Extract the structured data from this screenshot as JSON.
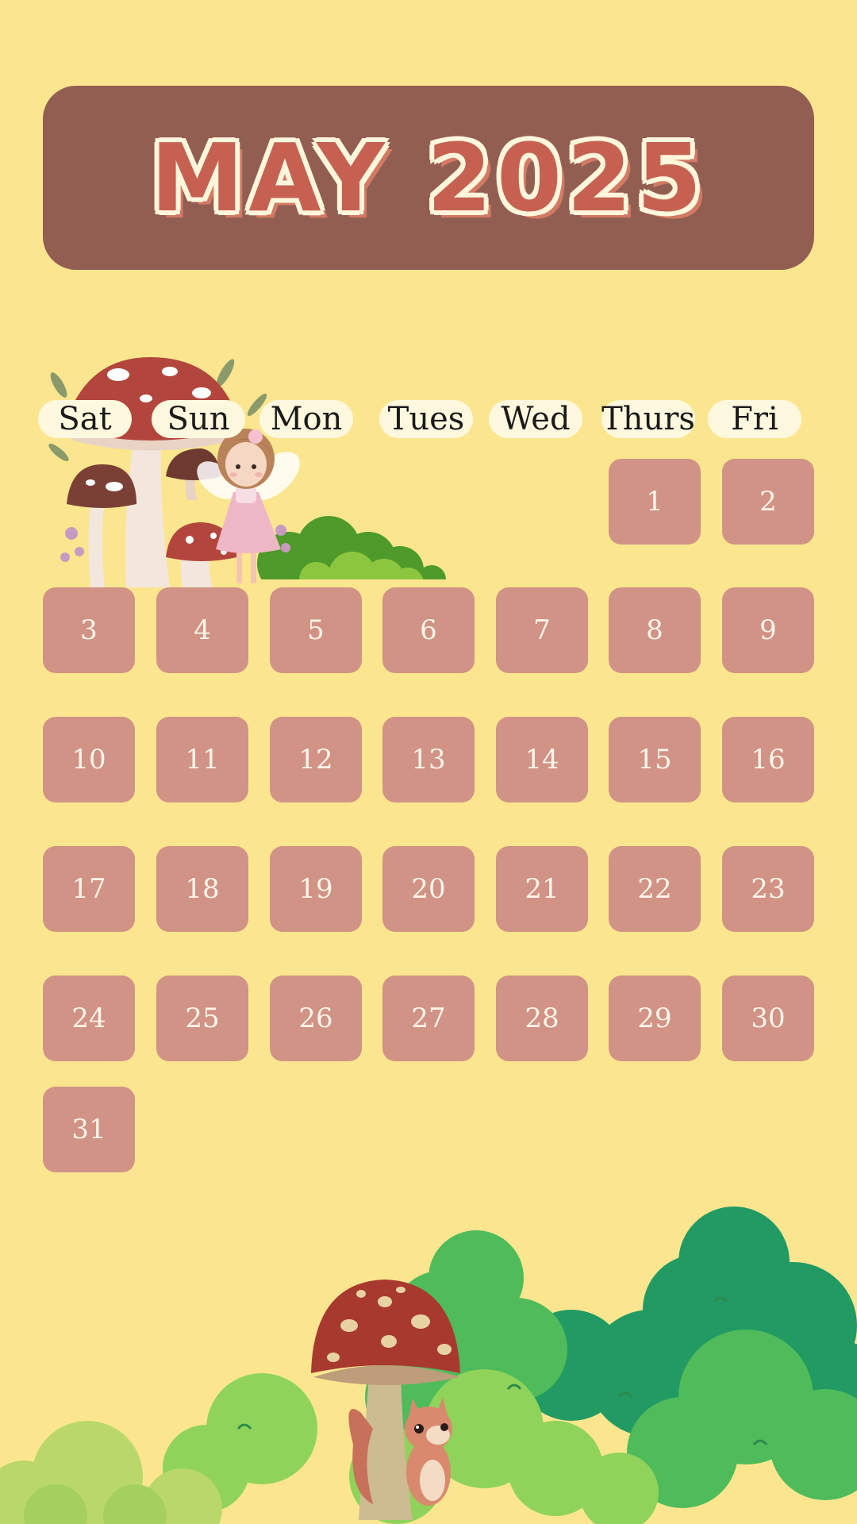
{
  "header": {
    "title": "MAY 2025"
  },
  "weekdays": [
    "Sat",
    "Sun",
    "Mon",
    "Tues",
    "Wed",
    "Thurs",
    "Fri"
  ],
  "days": [
    "1",
    "2",
    "3",
    "4",
    "5",
    "6",
    "7",
    "8",
    "9",
    "10",
    "11",
    "12",
    "13",
    "14",
    "15",
    "16",
    "17",
    "18",
    "19",
    "20",
    "21",
    "22",
    "23",
    "24",
    "25",
    "26",
    "27",
    "28",
    "29",
    "30",
    "31"
  ],
  "colors": {
    "background": "#fbe68f",
    "banner": "#935e52",
    "title": "#c66152",
    "day_cell": "#d19385",
    "weekday_pill": "#fef8de"
  },
  "decorations": {
    "top_left": [
      "mushroom-cluster-illustration",
      "fairy-illustration",
      "green-bush-illustration"
    ],
    "bottom": [
      "mushroom-illustration",
      "squirrel-illustration",
      "green-bushes-illustration"
    ]
  }
}
